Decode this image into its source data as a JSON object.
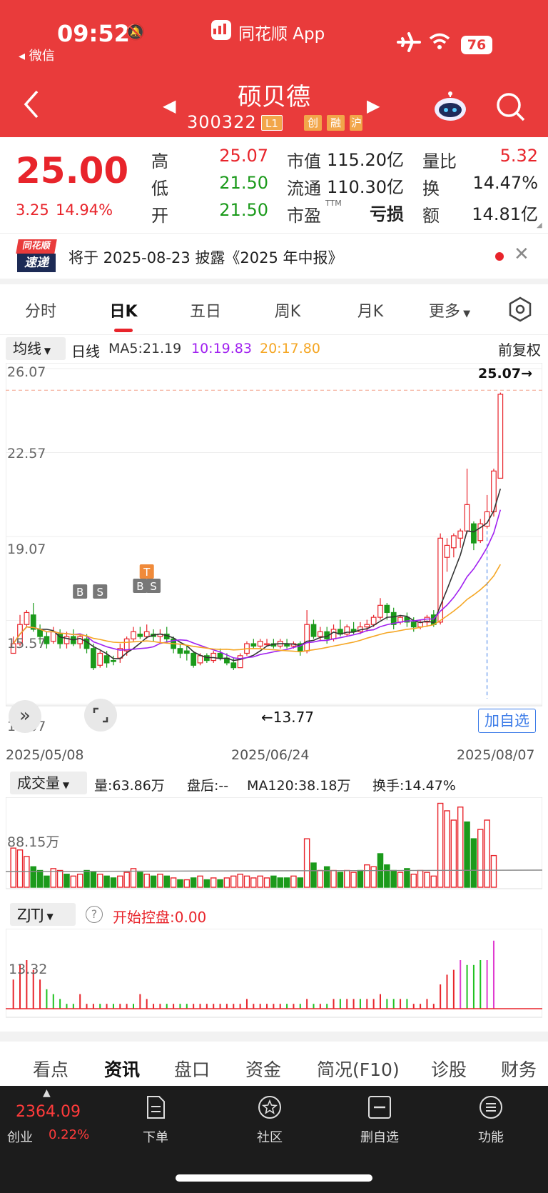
{
  "status": {
    "time": "09:52",
    "back_app": "微信",
    "battery": "76"
  },
  "header": {
    "app_title": "同花顺 App",
    "stock_name": "硕贝德",
    "stock_code": "300322",
    "tags": [
      "L1",
      "创",
      "融",
      "沪"
    ]
  },
  "quote": {
    "price": "25.00",
    "change": "3.25",
    "change_pct": "14.94%",
    "rows": [
      {
        "l1": "高",
        "v1": "25.07",
        "l2": "市值",
        "v2": "115.20亿",
        "l3": "量比",
        "v3": "5.32"
      },
      {
        "l1": "低",
        "v1": "21.50",
        "l2": "流通",
        "v2": "110.30亿",
        "l3": "换",
        "v3": "14.47%"
      },
      {
        "l1": "开",
        "v1": "21.50",
        "l2": "市盈",
        "l2sup": "TTM",
        "v2": "亏损",
        "l3": "额",
        "v3": "14.81亿"
      }
    ]
  },
  "notice": {
    "logo_top": "同花顺",
    "logo_bottom": "速递",
    "text": "将于 2025-08-23 披露《2025 年中报》"
  },
  "tabs": [
    "分时",
    "日K",
    "五日",
    "周K",
    "月K",
    "更多"
  ],
  "active_tab": "日K",
  "ma_bar": {
    "selector": "均线",
    "period": "日线",
    "ma5": "MA5:21.19",
    "ma10": "10:19.83",
    "ma20": "20:17.80",
    "adjust": "前复权"
  },
  "kline": {
    "y_ticks": [
      "26.07",
      "22.57",
      "19.07",
      "15.57",
      "12.07"
    ],
    "high_marker": "25.07",
    "low_marker": "13.77",
    "dates": [
      "2025/05/08",
      "2025/06/24",
      "2025/08/07"
    ],
    "add_watch": "加自选",
    "signals": [
      "B",
      "S",
      "B",
      "S",
      "T"
    ]
  },
  "volume": {
    "selector": "成交量",
    "amount": "量:63.86万",
    "after": "盘后:--",
    "ma120": "MA120:38.18万",
    "turnover": "换手:14.47%",
    "y_tick": "88.15万"
  },
  "indicator": {
    "selector": "ZJTJ",
    "help": "?",
    "value": "开始控盘:0.00",
    "y_tick": "13.32"
  },
  "bottom_tabs": [
    "看点",
    "资讯",
    "盘口",
    "资金",
    "简况(F10)",
    "诊股",
    "财务"
  ],
  "bottom_active": "资讯",
  "footer": {
    "index_value": "2364.09",
    "index_name": "创业",
    "index_pct": "0.22%",
    "items": [
      "下单",
      "社区",
      "删自选",
      "功能"
    ]
  },
  "colors": {
    "up": "#e8242b",
    "down": "#1b9a1b",
    "header": "#e93b3b",
    "ma5": "#333333",
    "ma10": "#a020f0",
    "ma20": "#f5a623"
  },
  "chart_data": {
    "type": "candlestick",
    "ylim": [
      12.07,
      26.07
    ],
    "candles": [
      [
        14.2,
        14.9,
        14.6,
        14.3,
        1
      ],
      [
        14.6,
        15.8,
        15.4,
        14.5,
        1
      ],
      [
        15.4,
        16.0,
        15.9,
        15.3,
        1
      ],
      [
        15.8,
        16.3,
        15.2,
        15.1,
        0
      ],
      [
        15.2,
        15.4,
        14.9,
        14.6,
        0
      ],
      [
        14.9,
        15.1,
        14.6,
        14.4,
        0
      ],
      [
        14.7,
        15.3,
        15.1,
        14.6,
        1
      ],
      [
        15.0,
        15.2,
        14.6,
        14.4,
        0
      ],
      [
        14.6,
        15.1,
        14.9,
        14.4,
        1
      ],
      [
        14.9,
        15.2,
        14.6,
        14.5,
        0
      ],
      [
        14.6,
        15.0,
        14.9,
        14.4,
        1
      ],
      [
        14.8,
        15.0,
        14.4,
        14.2,
        0
      ],
      [
        14.4,
        14.6,
        13.6,
        13.5,
        0
      ],
      [
        13.7,
        14.3,
        14.2,
        13.6,
        1
      ],
      [
        14.1,
        14.3,
        13.8,
        13.6,
        0
      ],
      [
        13.9,
        14.1,
        13.9,
        13.7,
        0
      ],
      [
        14.0,
        14.6,
        14.4,
        13.8,
        1
      ],
      [
        14.3,
        14.9,
        14.8,
        14.1,
        1
      ],
      [
        14.8,
        15.3,
        15.1,
        14.7,
        1
      ],
      [
        15.0,
        15.3,
        14.9,
        14.8,
        0
      ],
      [
        14.9,
        15.4,
        15.1,
        14.8,
        1
      ],
      [
        15.0,
        15.2,
        14.9,
        14.7,
        0
      ],
      [
        14.9,
        15.2,
        15.0,
        14.6,
        1
      ],
      [
        15.0,
        15.3,
        14.8,
        14.6,
        0
      ],
      [
        14.8,
        14.9,
        14.4,
        14.2,
        0
      ],
      [
        14.4,
        14.6,
        14.2,
        14.0,
        0
      ],
      [
        14.3,
        14.5,
        14.2,
        13.9,
        0
      ],
      [
        14.2,
        14.3,
        13.7,
        13.6,
        0
      ],
      [
        13.8,
        14.2,
        14.1,
        13.7,
        1
      ],
      [
        14.1,
        14.2,
        13.9,
        13.8,
        0
      ],
      [
        13.9,
        14.3,
        14.2,
        13.8,
        1
      ],
      [
        14.2,
        14.4,
        14.0,
        13.9,
        0
      ],
      [
        14.0,
        14.2,
        13.8,
        13.7,
        0
      ],
      [
        13.8,
        14.0,
        13.6,
        13.5,
        0
      ],
      [
        13.6,
        14.2,
        14.1,
        13.77,
        1
      ],
      [
        14.2,
        14.7,
        14.6,
        14.1,
        1
      ],
      [
        14.6,
        14.8,
        14.5,
        14.4,
        0
      ],
      [
        14.5,
        14.8,
        14.7,
        14.4,
        1
      ],
      [
        14.6,
        14.8,
        14.6,
        14.5,
        1
      ],
      [
        14.6,
        14.8,
        14.5,
        14.4,
        0
      ],
      [
        14.5,
        14.8,
        14.7,
        14.4,
        1
      ],
      [
        14.6,
        14.8,
        14.5,
        14.4,
        0
      ],
      [
        14.5,
        14.7,
        14.6,
        14.4,
        1
      ],
      [
        14.6,
        14.7,
        14.3,
        14.1,
        0
      ],
      [
        14.3,
        16.0,
        15.4,
        14.2,
        1
      ],
      [
        15.4,
        15.6,
        14.9,
        14.8,
        0
      ],
      [
        14.9,
        15.3,
        15.1,
        14.7,
        1
      ],
      [
        15.1,
        15.3,
        14.8,
        14.6,
        0
      ],
      [
        14.8,
        15.4,
        15.2,
        14.7,
        1
      ],
      [
        15.2,
        15.6,
        15.0,
        14.9,
        0
      ],
      [
        15.0,
        15.4,
        15.3,
        14.9,
        1
      ],
      [
        15.2,
        15.5,
        15.1,
        15.0,
        0
      ],
      [
        15.1,
        15.5,
        15.3,
        15.0,
        1
      ],
      [
        15.3,
        15.6,
        15.4,
        15.1,
        1
      ],
      [
        15.4,
        15.8,
        15.7,
        15.3,
        1
      ],
      [
        15.7,
        16.5,
        16.2,
        15.6,
        1
      ],
      [
        16.2,
        16.3,
        15.9,
        15.6,
        0
      ],
      [
        15.9,
        16.1,
        15.4,
        15.2,
        0
      ],
      [
        15.5,
        15.8,
        15.7,
        15.4,
        1
      ],
      [
        15.7,
        15.9,
        15.5,
        15.3,
        0
      ],
      [
        15.5,
        15.7,
        15.3,
        15.1,
        0
      ],
      [
        15.3,
        15.6,
        15.5,
        15.2,
        1
      ],
      [
        15.5,
        15.8,
        15.7,
        15.3,
        1
      ],
      [
        15.8,
        16.0,
        15.4,
        15.3,
        0
      ],
      [
        15.5,
        19.2,
        19.0,
        15.4,
        1
      ],
      [
        18.2,
        19.0,
        18.7,
        17.6,
        1
      ],
      [
        18.6,
        19.2,
        19.1,
        18.2,
        1
      ],
      [
        19.0,
        19.4,
        19.3,
        18.6,
        1
      ],
      [
        19.3,
        21.9,
        20.4,
        19.2,
        1
      ],
      [
        19.6,
        19.7,
        18.8,
        18.5,
        0
      ],
      [
        18.9,
        19.8,
        19.6,
        18.8,
        1
      ],
      [
        19.5,
        20.8,
        20.1,
        19.4,
        1
      ],
      [
        20.1,
        21.9,
        21.8,
        19.9,
        1
      ],
      [
        21.5,
        25.07,
        25.0,
        21.5,
        1
      ]
    ],
    "volume": [
      [
        42,
        1
      ],
      [
        40,
        1
      ],
      [
        33,
        1
      ],
      [
        22,
        0
      ],
      [
        18,
        0
      ],
      [
        12,
        0
      ],
      [
        20,
        1
      ],
      [
        18,
        1
      ],
      [
        14,
        0
      ],
      [
        12,
        1
      ],
      [
        14,
        1
      ],
      [
        18,
        0
      ],
      [
        16,
        0
      ],
      [
        14,
        1
      ],
      [
        12,
        0
      ],
      [
        10,
        0
      ],
      [
        12,
        1
      ],
      [
        16,
        1
      ],
      [
        20,
        1
      ],
      [
        16,
        0
      ],
      [
        14,
        1
      ],
      [
        12,
        0
      ],
      [
        14,
        1
      ],
      [
        12,
        0
      ],
      [
        10,
        1
      ],
      [
        8,
        0
      ],
      [
        8,
        1
      ],
      [
        10,
        0
      ],
      [
        12,
        1
      ],
      [
        8,
        0
      ],
      [
        10,
        1
      ],
      [
        8,
        0
      ],
      [
        10,
        1
      ],
      [
        12,
        1
      ],
      [
        14,
        1
      ],
      [
        12,
        1
      ],
      [
        10,
        1
      ],
      [
        12,
        1
      ],
      [
        10,
        1
      ],
      [
        12,
        0
      ],
      [
        10,
        0
      ],
      [
        10,
        0
      ],
      [
        12,
        1
      ],
      [
        10,
        0
      ],
      [
        52,
        1
      ],
      [
        26,
        0
      ],
      [
        18,
        1
      ],
      [
        22,
        0
      ],
      [
        18,
        1
      ],
      [
        16,
        0
      ],
      [
        18,
        1
      ],
      [
        16,
        1
      ],
      [
        18,
        0
      ],
      [
        24,
        1
      ],
      [
        22,
        1
      ],
      [
        36,
        0
      ],
      [
        24,
        0
      ],
      [
        18,
        0
      ],
      [
        16,
        1
      ],
      [
        20,
        0
      ],
      [
        14,
        1
      ],
      [
        18,
        1
      ],
      [
        16,
        1
      ],
      [
        12,
        1
      ],
      [
        90,
        1
      ],
      [
        82,
        1
      ],
      [
        72,
        1
      ],
      [
        86,
        1
      ],
      [
        70,
        0
      ],
      [
        52,
        0
      ],
      [
        62,
        1
      ],
      [
        72,
        1
      ],
      [
        34,
        1
      ]
    ],
    "indicator": [
      [
        6,
        1
      ],
      [
        9,
        1
      ],
      [
        10,
        1
      ],
      [
        8,
        1
      ],
      [
        6,
        1
      ],
      [
        4,
        0
      ],
      [
        3,
        0
      ],
      [
        2,
        0
      ],
      [
        1,
        0
      ],
      [
        1,
        0
      ],
      [
        3,
        1
      ],
      [
        1,
        1
      ],
      [
        1,
        1
      ],
      [
        1,
        0
      ],
      [
        1,
        1
      ],
      [
        1,
        0
      ],
      [
        1,
        1
      ],
      [
        1,
        1
      ],
      [
        1,
        0
      ],
      [
        3,
        1
      ],
      [
        2,
        1
      ],
      [
        1,
        1
      ],
      [
        1,
        1
      ],
      [
        1,
        0
      ],
      [
        1,
        1
      ],
      [
        1,
        0
      ],
      [
        1,
        0
      ],
      [
        1,
        1
      ],
      [
        1,
        1
      ],
      [
        1,
        1
      ],
      [
        1,
        1
      ],
      [
        1,
        1
      ],
      [
        1,
        1
      ],
      [
        1,
        1
      ],
      [
        1,
        1
      ],
      [
        2,
        1
      ],
      [
        1,
        1
      ],
      [
        1,
        1
      ],
      [
        1,
        1
      ],
      [
        1,
        1
      ],
      [
        1,
        1
      ],
      [
        1,
        0
      ],
      [
        1,
        1
      ],
      [
        1,
        0
      ],
      [
        2,
        1
      ],
      [
        1,
        0
      ],
      [
        1,
        1
      ],
      [
        1,
        0
      ],
      [
        2,
        1
      ],
      [
        2,
        0
      ],
      [
        2,
        1
      ],
      [
        2,
        1
      ],
      [
        2,
        0
      ],
      [
        2,
        1
      ],
      [
        2,
        1
      ],
      [
        3,
        1
      ],
      [
        2,
        0
      ],
      [
        2,
        0
      ],
      [
        2,
        1
      ],
      [
        2,
        0
      ],
      [
        1,
        1
      ],
      [
        1,
        1
      ],
      [
        2,
        1
      ],
      [
        1,
        1
      ],
      [
        5,
        1
      ],
      [
        7,
        1
      ],
      [
        8,
        1
      ],
      [
        10,
        1
      ],
      [
        9,
        0
      ],
      [
        9,
        0
      ],
      [
        10,
        0
      ],
      [
        10,
        1
      ],
      [
        14,
        1
      ]
    ]
  }
}
